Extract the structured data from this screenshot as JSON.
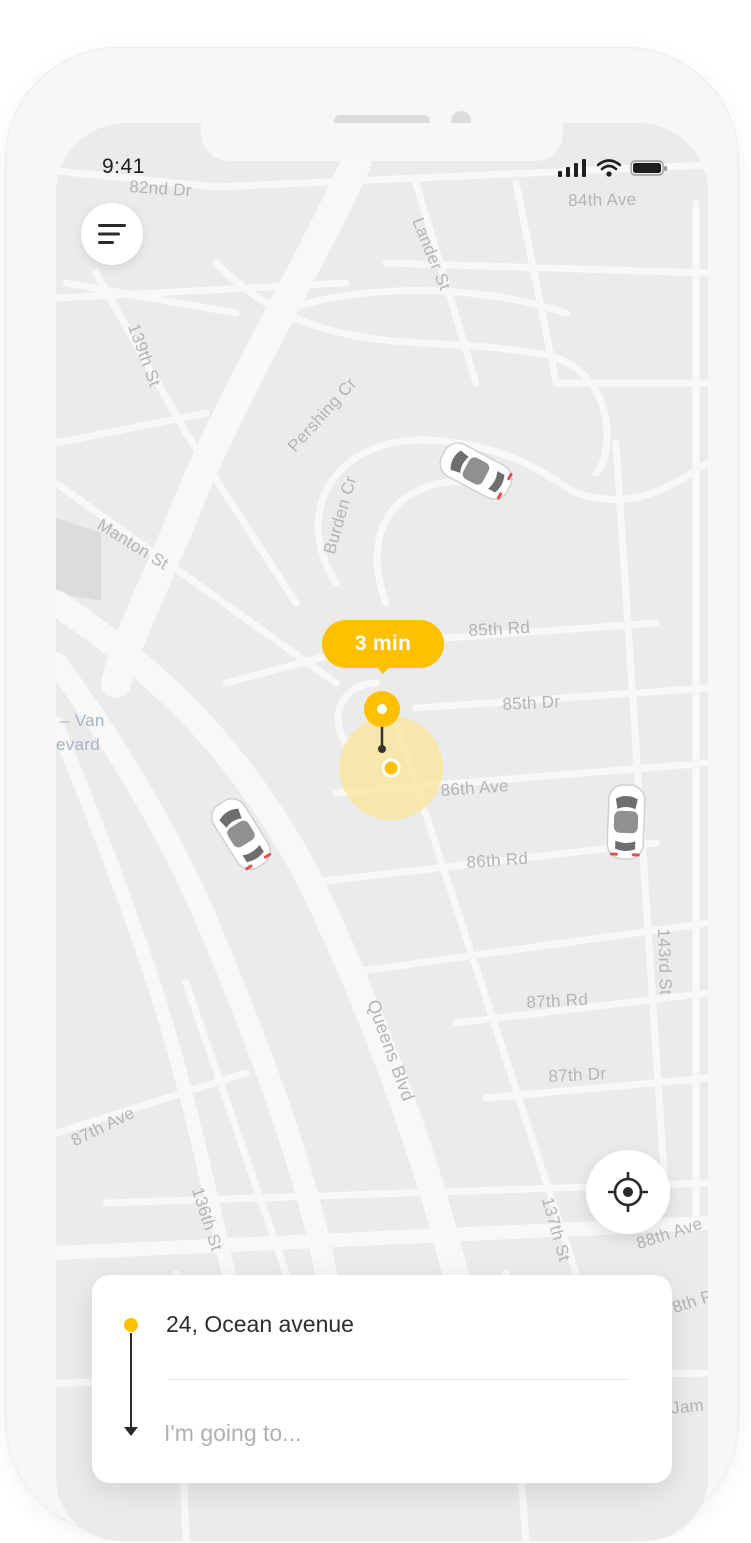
{
  "status_bar": {
    "time": "9:41",
    "signal_icon": "cellular-signal-icon",
    "wifi_icon": "wifi-icon",
    "battery_icon": "battery-icon"
  },
  "map": {
    "streets": {
      "s82nd_dr": "82nd Dr",
      "s84th_ave": "84th Ave",
      "lander_st": "Lander St",
      "s139th_st": "139th St",
      "pershing_cr": "Pershing Cr",
      "burden_cr": "Burden Cr",
      "manton_st": "Manton St",
      "s85th_rd": "85th Rd",
      "s85th_dr": "85th Dr",
      "s86th_ave": "86th Ave",
      "s86th_rd": "86th Rd",
      "van_line1": "– Van",
      "van_line2": "evard",
      "s143rd_st": "143rd St",
      "s87th_rd": "87th Rd",
      "s87th_dr": "87th Dr",
      "queens_blvd": "Queens Blvd",
      "s87th_ave": "87th Ave",
      "s136th_st": "136th St",
      "s137th_st": "137th St",
      "s88th_ave": "88th Ave",
      "partial_8th_p": "8th P",
      "partial_jam": "Jam"
    },
    "eta_label": "3 min",
    "accent_color": "#ffc000"
  },
  "buttons": {
    "menu_icon": "menu-icon",
    "locate_icon": "crosshair-icon"
  },
  "trip_card": {
    "origin": "24, Ocean avenue",
    "destination_placeholder": "I'm going to..."
  }
}
